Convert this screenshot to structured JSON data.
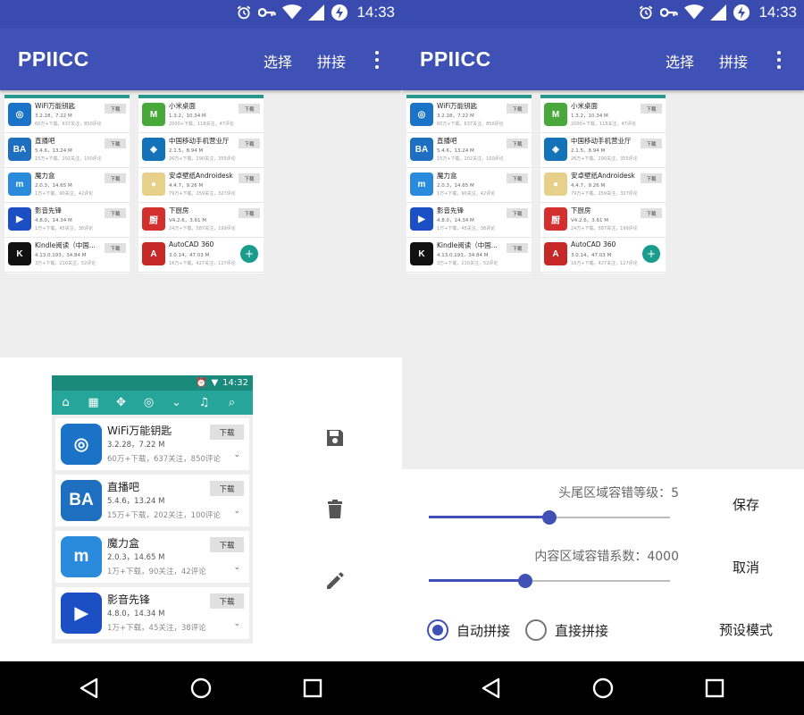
{
  "status": {
    "time": "14:33"
  },
  "appbar": {
    "title": "PPIICC",
    "select_label": "选择",
    "stitch_label": "拼接"
  },
  "colors": {
    "primary": "#3f51b5",
    "teal": "#26a69a",
    "accent": "#1a9c8c"
  },
  "mini_left": [
    {
      "name": "WiFi万能钥匙",
      "version": "3.2.28，7.22 M",
      "stats": "60万+下载，637关注，850评论",
      "icon": "wifi-key-icon",
      "color": "#1a73c6",
      "glyph": "◎"
    },
    {
      "name": "直播吧",
      "version": "5.4.6，13.24 M",
      "stats": "15万+下载，202关注，100评论",
      "icon": "ba-icon",
      "color": "#1e6fc0",
      "glyph": "BA"
    },
    {
      "name": "魔力盒",
      "version": "2.0.3，14.65 M",
      "stats": "1万+下载，90关注，42评论",
      "icon": "m-box-icon",
      "color": "#2a8bdc",
      "glyph": "m"
    },
    {
      "name": "影音先锋",
      "version": "4.8.0，14.34 M",
      "stats": "1万+下载，45关注，38评论",
      "icon": "play-icon",
      "color": "#1d4fc4",
      "glyph": "▶"
    },
    {
      "name": "Kindle阅读（中国...",
      "version": "4.13.0.193，34.84 M",
      "stats": "3万+下载，210关注，52评论",
      "icon": "kindle-icon",
      "color": "#111111",
      "glyph": "K"
    }
  ],
  "mini_right": [
    {
      "name": "小米桌面",
      "version": "1.3.2，10.34 M",
      "stats": "2000+下载，118关注，47评论",
      "icon": "xiaomi-desk-icon",
      "color": "#48a93a",
      "glyph": "M"
    },
    {
      "name": "中国移动手机营业厅",
      "version": "2.1.5，8.94 M",
      "stats": "26万+下载，290关注，355评论",
      "icon": "china-mobile-icon",
      "color": "#1473b8",
      "glyph": "◈"
    },
    {
      "name": "安卓壁纸Androidesk",
      "version": "4.4.7，9.26 M",
      "stats": "79万+下载，259关注，327评论",
      "icon": "egg-icon",
      "color": "#e6d08a",
      "glyph": "●"
    },
    {
      "name": "下厨房",
      "version": "V4.2.6，3.61 M",
      "stats": "24万+下载，587关注，199评论",
      "icon": "kitchen-icon",
      "color": "#d32f2f",
      "glyph": "厨"
    },
    {
      "name": "AutoCAD 360",
      "version": "3.0.14，47.03 M",
      "stats": "16万+下载，427关注，127评论",
      "icon": "autocad-icon",
      "color": "#c62828",
      "glyph": "A"
    }
  ],
  "mini_download": "下载",
  "preview": {
    "time": "14:32",
    "download": "下载",
    "rows": [
      {
        "name": "WiFi万能钥匙",
        "version": "3.2.28，7.22 M",
        "stats": "60万+下载，637关注，850评论",
        "color": "#1a73c6",
        "glyph": "◎"
      },
      {
        "name": "直播吧",
        "version": "5.4.6，13.24 M",
        "stats": "15万+下载，202关注，100评论",
        "color": "#1e6fc0",
        "glyph": "BA"
      },
      {
        "name": "魔力盒",
        "version": "2.0.3，14.65 M",
        "stats": "1万+下载，90关注，42评论",
        "color": "#2a8bdc",
        "glyph": "m"
      },
      {
        "name": "影音先锋",
        "version": "4.8.0，14.34 M",
        "stats": "1万+下载，45关注，38评论",
        "color": "#1d4fc4",
        "glyph": "▶"
      }
    ]
  },
  "settings": {
    "head_tail_label": "头尾区域容错等级：5",
    "head_tail_level": 0.5,
    "content_label": "内容区域容错系数：4000",
    "content_level": 0.4,
    "save": "保存",
    "cancel": "取消",
    "preset": "预设模式",
    "radio_auto": "自动拼接",
    "radio_direct": "直接拼接"
  }
}
